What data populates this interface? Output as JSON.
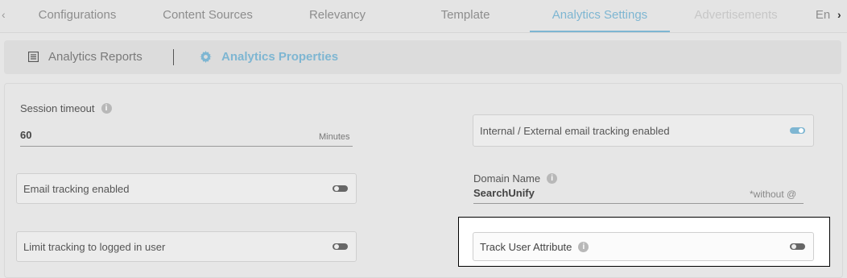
{
  "tabs": {
    "items": [
      "Configurations",
      "Content Sources",
      "Relevancy",
      "Template",
      "Analytics Settings",
      "Advertisements",
      "En"
    ],
    "active": "Analytics Settings"
  },
  "subtabs": {
    "reports": "Analytics Reports",
    "properties": "Analytics Properties"
  },
  "settings": {
    "session_timeout_label": "Session timeout",
    "session_timeout_value": "60",
    "session_timeout_unit": "Minutes",
    "internal_external_label": "Internal / External email tracking enabled",
    "internal_external_on": true,
    "email_tracking_label": "Email tracking enabled",
    "email_tracking_on": false,
    "domain_label": "Domain Name",
    "domain_value": "SearchUnify",
    "domain_suffix": "*without @",
    "limit_label": "Limit tracking to logged in user",
    "limit_on": false,
    "track_attr_label": "Track User Attribute",
    "track_attr_on": false
  },
  "colors": {
    "accent": "#7eb6d2",
    "background": "#e6e6e6"
  }
}
